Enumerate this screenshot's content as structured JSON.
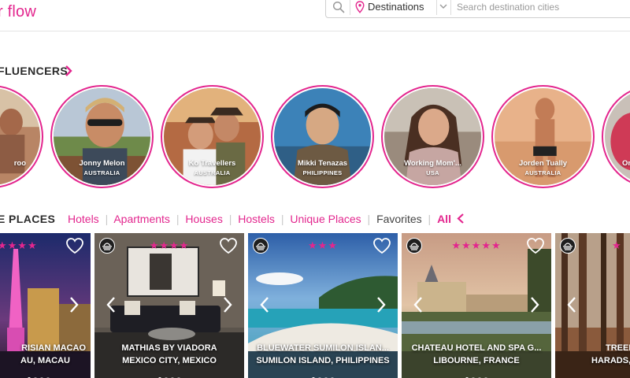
{
  "header": {
    "brand_partial": "r flow",
    "destination_dropdown": "Destinations",
    "search_placeholder": "Search destination cities"
  },
  "influencers": {
    "section_title": "FLUENCERS",
    "items": [
      {
        "name": "roo",
        "country": ""
      },
      {
        "name": "Jonny Melon",
        "country": "AUSTRALIA"
      },
      {
        "name": "Ko Travellers",
        "country": "AUSTRALIA"
      },
      {
        "name": "Mikki Tenazas",
        "country": "PHILIPPINES"
      },
      {
        "name": "Working Mom'...",
        "country": "USA"
      },
      {
        "name": "Jorden Tually",
        "country": "AUSTRALIA"
      },
      {
        "name": "On",
        "country": ""
      }
    ]
  },
  "places_nav": {
    "label": "E PLACES",
    "links": [
      "Hotels",
      "Apartments",
      "Houses",
      "Hostels",
      "Unique Places"
    ],
    "favorites": "Favorites",
    "all": "All"
  },
  "properties": [
    {
      "title": "RISIAN MACAO",
      "location": "AU, MACAU",
      "stars": "★★★★",
      "rating": 4
    },
    {
      "title": "MATHIAS BY VIADORA",
      "location": "MEXICO CITY, MEXICO",
      "stars": "★★★★",
      "rating": 4
    },
    {
      "title": "BLUEWATER SUMILON ISLAN...",
      "location": "SUMILON ISLAND, PHILIPPINES",
      "stars": "★★★",
      "rating": 3
    },
    {
      "title": "CHATEAU HOTEL AND SPA G...",
      "location": "LIBOURNE, FRANCE",
      "stars": "★★★★★",
      "rating": 5
    },
    {
      "title": "TREEH",
      "location": "HARADS,",
      "stars": "★",
      "rating": 1
    }
  ],
  "colors": {
    "accent": "#e3268e",
    "text_dark": "#2b2b2b"
  }
}
